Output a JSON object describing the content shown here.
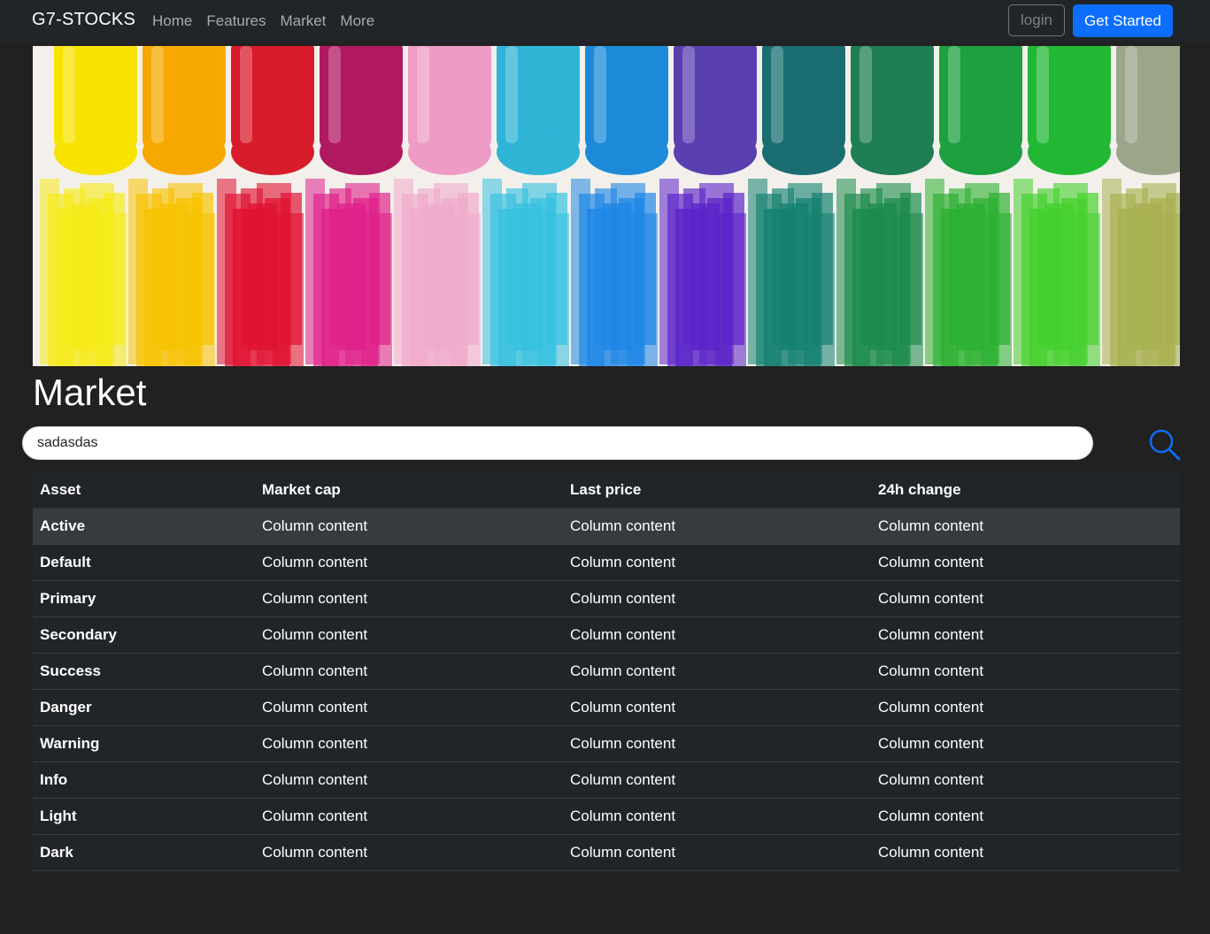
{
  "navbar": {
    "brand": "G7-STOCKS",
    "links": [
      "Home",
      "Features",
      "Market",
      "More"
    ],
    "login_label": "login",
    "get_started_label": "Get Started"
  },
  "hero": {
    "image": "colorful-oil-pastels"
  },
  "page_title": "Market",
  "search": {
    "value": "sadasdas",
    "icon": "search-icon",
    "icon_color": "#0d6efd"
  },
  "table": {
    "headers": [
      "Asset",
      "Market cap",
      "Last price",
      "24h change"
    ],
    "rows": [
      {
        "asset": "Active",
        "cells": [
          "Column content",
          "Column content",
          "Column content"
        ]
      },
      {
        "asset": "Default",
        "cells": [
          "Column content",
          "Column content",
          "Column content"
        ]
      },
      {
        "asset": "Primary",
        "cells": [
          "Column content",
          "Column content",
          "Column content"
        ]
      },
      {
        "asset": "Secondary",
        "cells": [
          "Column content",
          "Column content",
          "Column content"
        ]
      },
      {
        "asset": "Success",
        "cells": [
          "Column content",
          "Column content",
          "Column content"
        ]
      },
      {
        "asset": "Danger",
        "cells": [
          "Column content",
          "Column content",
          "Column content"
        ]
      },
      {
        "asset": "Warning",
        "cells": [
          "Column content",
          "Column content",
          "Column content"
        ]
      },
      {
        "asset": "Info",
        "cells": [
          "Column content",
          "Column content",
          "Column content"
        ]
      },
      {
        "asset": "Light",
        "cells": [
          "Column content",
          "Column content",
          "Column content"
        ]
      },
      {
        "asset": "Dark",
        "cells": [
          "Column content",
          "Column content",
          "Column content"
        ]
      }
    ]
  },
  "colors": {
    "background": "#212121",
    "navbar": "#212529",
    "primary": "#0d6efd",
    "active_row": "#373b3e"
  }
}
